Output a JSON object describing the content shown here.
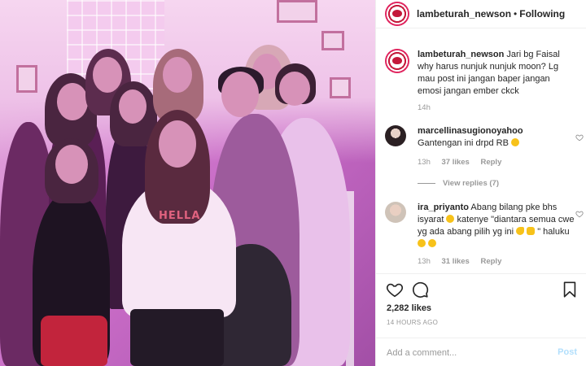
{
  "post": {
    "username": "lambeturah_newson",
    "follow_dot": "•",
    "follow_status": "Following",
    "caption_username": "lambeturah_newson",
    "caption_text": "Jari bg Faisal why harus nunjuk nunjuk moon? Lg mau post ini jangan baper jangan emosi jangan ember ckck",
    "caption_age": "14h",
    "photo_shirt_text": "HELLA"
  },
  "comments": [
    {
      "username": "marcellinasugionoyahoo",
      "text": "Gantengan ini drpd RB",
      "age": "13h",
      "likes": "37 likes",
      "reply": "Reply"
    },
    {
      "username": "ira_priyanto",
      "text": "Abang bilang pke bhs isyarat",
      "text2": "katenye \"diantara semua cwe yg ada abang pilih yg ini",
      "text3": "\" haluku",
      "age": "13h",
      "likes": "31 likes",
      "reply": "Reply"
    }
  ],
  "view_replies": "View replies (7)",
  "actions": {
    "likes": "2,282 likes",
    "date": "14 HOURS AGO",
    "comment_placeholder": "Add a comment...",
    "post_label": "Post"
  },
  "icons": {
    "like": "heart-icon",
    "comment": "comment-icon",
    "save": "bookmark-icon",
    "comment_like": "heart-icon"
  },
  "colors": {
    "brand_red": "#e0245e",
    "post_disabled": "#b2dffc",
    "muted": "#999999",
    "text": "#262626"
  }
}
